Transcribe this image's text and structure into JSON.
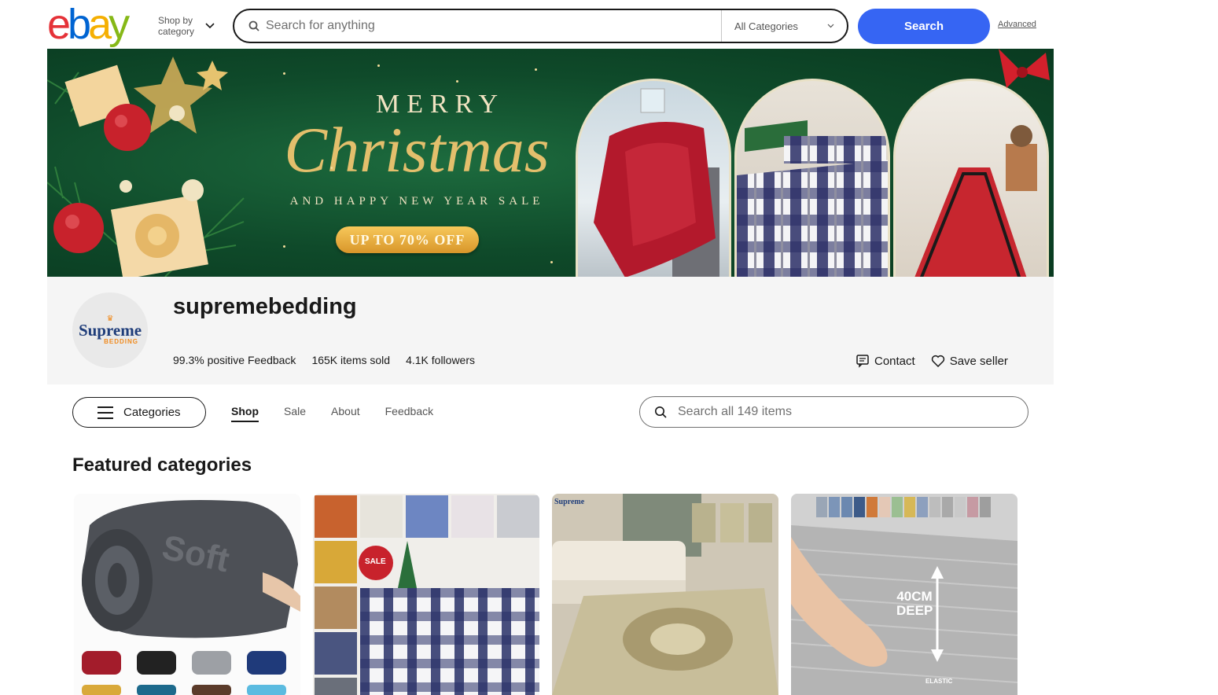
{
  "header": {
    "logo_letters": [
      "e",
      "b",
      "a",
      "y"
    ],
    "shop_by_label": "Shop by category",
    "search_placeholder": "Search for anything",
    "category_select": "All Categories",
    "search_button": "Search",
    "advanced_link": "Advanced"
  },
  "banner": {
    "line1": "MERRY",
    "line2": "Christmas",
    "line3": "AND HAPPY NEW YEAR SALE",
    "offer": "UP TO 70% OFF"
  },
  "seller": {
    "name": "supremebedding",
    "logo_text": "Supreme",
    "logo_subtext": "BEDDING",
    "feedback_value": "99.3%",
    "feedback_label": "positive Feedback",
    "sold_value": "165K",
    "sold_label": "items sold",
    "followers_value": "4.1K",
    "followers_label": "followers",
    "contact_label": "Contact",
    "save_label": "Save seller"
  },
  "store_nav": {
    "categories_label": "Categories",
    "tabs": [
      "Shop",
      "Sale",
      "About",
      "Feedback"
    ],
    "active_tab": "Shop",
    "search_placeholder": "Search all 149 items"
  },
  "featured": {
    "title": "Featured categories",
    "cards": [
      {
        "image_text": "Soft"
      },
      {
        "image_text": "SALE"
      },
      {
        "image_text": "Supreme"
      },
      {
        "image_text": "40CM DEEP",
        "image_subtext": "ELASTIC"
      }
    ]
  },
  "colors": {
    "search_blue": "#3665f3",
    "banner_green": "#0f4a2a",
    "gold": "#e3bf6c",
    "panel_gray": "#f5f5f5"
  }
}
